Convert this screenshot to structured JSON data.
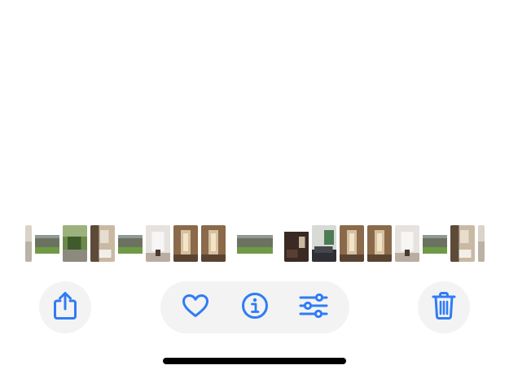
{
  "viewer": {
    "background": "#ffffff"
  },
  "thumbnails": [
    {
      "kind": "sliver-edge"
    },
    {
      "kind": "house-exterior"
    },
    {
      "kind": "garden-green"
    },
    {
      "kind": "bathroom"
    },
    {
      "kind": "house-exterior"
    },
    {
      "kind": "white-room"
    },
    {
      "kind": "hallway-warm"
    },
    {
      "kind": "hallway-warm"
    },
    {
      "kind": "house-exterior",
      "selected": true
    },
    {
      "kind": "dark-room"
    },
    {
      "kind": "window-room"
    },
    {
      "kind": "hallway-warm"
    },
    {
      "kind": "hallway-warm"
    },
    {
      "kind": "white-room"
    },
    {
      "kind": "house-exterior"
    },
    {
      "kind": "bathroom"
    },
    {
      "kind": "sliver-edge"
    }
  ],
  "toolbar": {
    "accent_color": "#2f7cf6",
    "button_background": "#f3f3f3",
    "share_icon": "share-icon",
    "favorite_icon": "heart-icon",
    "info_icon": "info-icon",
    "adjust_icon": "sliders-icon",
    "delete_icon": "trash-icon"
  }
}
